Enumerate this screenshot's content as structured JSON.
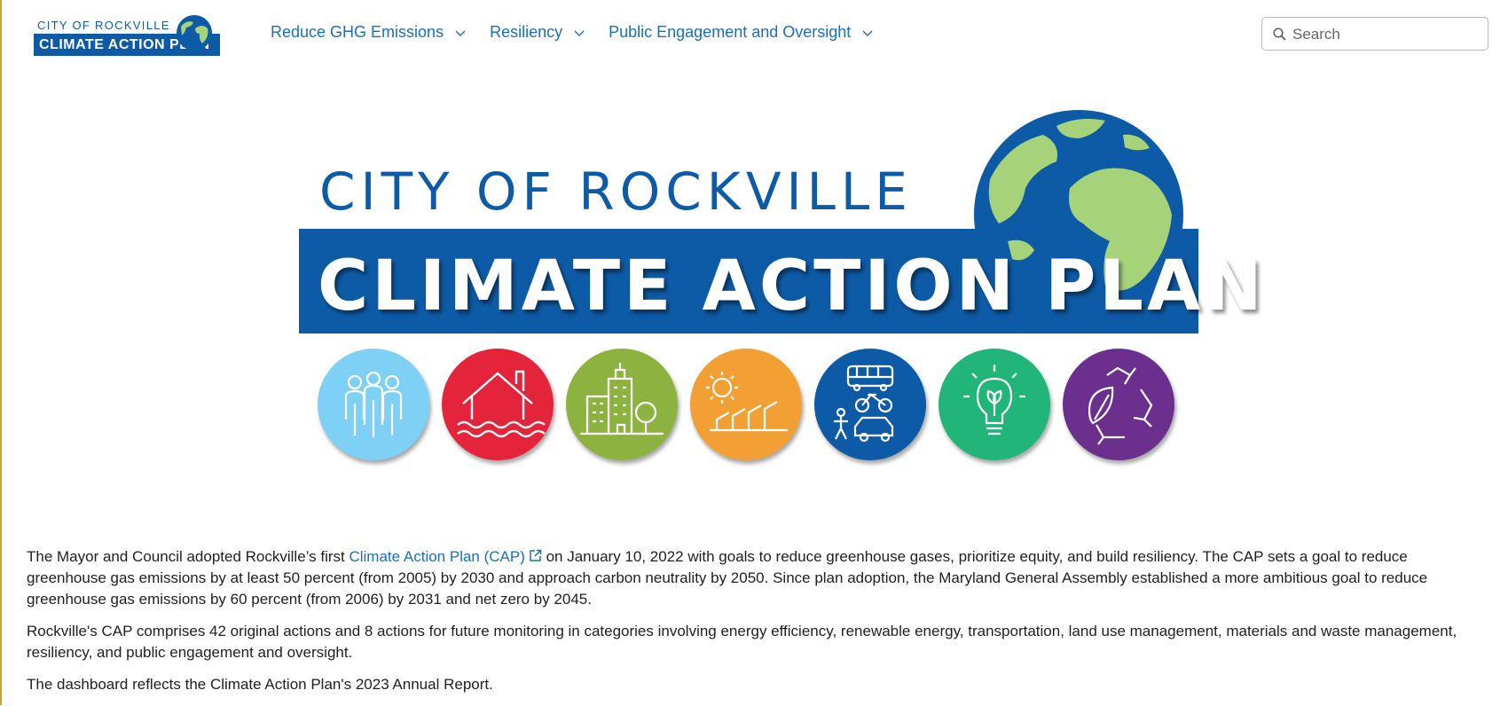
{
  "header": {
    "logo": {
      "line1": "CITY OF ROCKVILLE",
      "line2": "CLIMATE ACTION PLAN"
    },
    "nav": [
      {
        "label": "Reduce GHG Emissions"
      },
      {
        "label": "Resiliency"
      },
      {
        "label": "Public Engagement and Oversight"
      }
    ],
    "search": {
      "placeholder": "Search",
      "value": ""
    }
  },
  "banner": {
    "title_top": "CITY OF ROCKVILLE",
    "title_main": "CLIMATE ACTION PLAN",
    "categories": [
      {
        "icon": "people-icon",
        "color": "#7fd0f5"
      },
      {
        "icon": "flooded-house-icon",
        "color": "#e3243b"
      },
      {
        "icon": "buildings-icon",
        "color": "#8cb33f"
      },
      {
        "icon": "solar-icon",
        "color": "#f2a033"
      },
      {
        "icon": "transportation-icon",
        "color": "#0d5ba6"
      },
      {
        "icon": "lightbulb-leaf-icon",
        "color": "#22b57a"
      },
      {
        "icon": "recycle-leaf-icon",
        "color": "#6b2f8e"
      }
    ]
  },
  "content": {
    "p1_before": "The Mayor and Council adopted Rockville’s first ",
    "p1_link": "Climate Action Plan (CAP)",
    "p1_after": " on January 10, 2022 with goals to reduce greenhouse gases, prioritize equity, and build resiliency. The CAP sets a goal to reduce greenhouse gas emissions by at least 50 percent (from 2005) by 2030 and approach carbon neutrality by 2050. Since plan adoption, the Maryland General Assembly established a more ambitious goal to reduce greenhouse gas emissions by 60 percent (from 2006) by 2031 and net zero by 2045.",
    "p2": "Rockville's CAP comprises 42 original actions and 8 actions for future monitoring in categories involving energy efficiency, renewable energy, transportation, land use management, materials and waste management, resiliency, and public engagement and oversight.",
    "p3": "The dashboard reflects the Climate Action Plan's 2023 Annual Report."
  },
  "colors": {
    "brand_blue": "#0d5ba6",
    "link": "#1a6fba",
    "globe_green": "#a6d27a"
  }
}
